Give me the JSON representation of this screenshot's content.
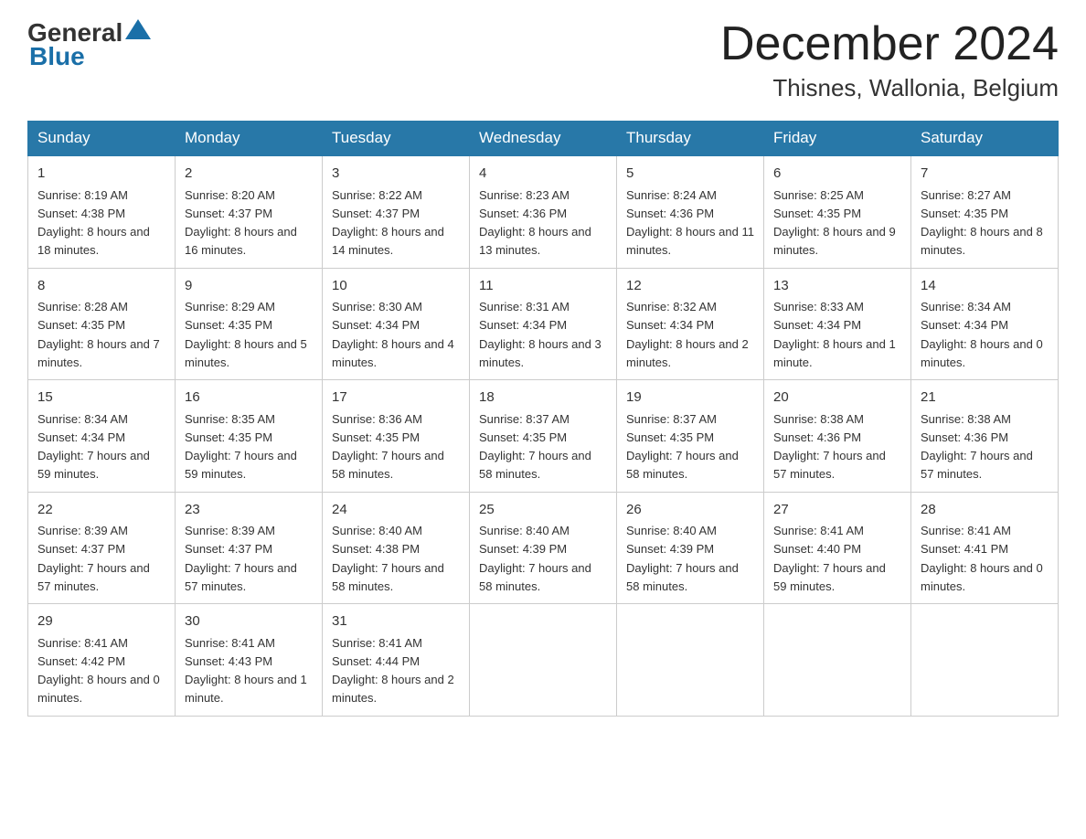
{
  "header": {
    "logo_general": "General",
    "logo_blue": "Blue",
    "month_year": "December 2024",
    "location": "Thisnes, Wallonia, Belgium"
  },
  "days_of_week": [
    "Sunday",
    "Monday",
    "Tuesday",
    "Wednesday",
    "Thursday",
    "Friday",
    "Saturday"
  ],
  "weeks": [
    [
      {
        "day": "1",
        "sunrise": "8:19 AM",
        "sunset": "4:38 PM",
        "daylight": "8 hours and 18 minutes."
      },
      {
        "day": "2",
        "sunrise": "8:20 AM",
        "sunset": "4:37 PM",
        "daylight": "8 hours and 16 minutes."
      },
      {
        "day": "3",
        "sunrise": "8:22 AM",
        "sunset": "4:37 PM",
        "daylight": "8 hours and 14 minutes."
      },
      {
        "day": "4",
        "sunrise": "8:23 AM",
        "sunset": "4:36 PM",
        "daylight": "8 hours and 13 minutes."
      },
      {
        "day": "5",
        "sunrise": "8:24 AM",
        "sunset": "4:36 PM",
        "daylight": "8 hours and 11 minutes."
      },
      {
        "day": "6",
        "sunrise": "8:25 AM",
        "sunset": "4:35 PM",
        "daylight": "8 hours and 9 minutes."
      },
      {
        "day": "7",
        "sunrise": "8:27 AM",
        "sunset": "4:35 PM",
        "daylight": "8 hours and 8 minutes."
      }
    ],
    [
      {
        "day": "8",
        "sunrise": "8:28 AM",
        "sunset": "4:35 PM",
        "daylight": "8 hours and 7 minutes."
      },
      {
        "day": "9",
        "sunrise": "8:29 AM",
        "sunset": "4:35 PM",
        "daylight": "8 hours and 5 minutes."
      },
      {
        "day": "10",
        "sunrise": "8:30 AM",
        "sunset": "4:34 PM",
        "daylight": "8 hours and 4 minutes."
      },
      {
        "day": "11",
        "sunrise": "8:31 AM",
        "sunset": "4:34 PM",
        "daylight": "8 hours and 3 minutes."
      },
      {
        "day": "12",
        "sunrise": "8:32 AM",
        "sunset": "4:34 PM",
        "daylight": "8 hours and 2 minutes."
      },
      {
        "day": "13",
        "sunrise": "8:33 AM",
        "sunset": "4:34 PM",
        "daylight": "8 hours and 1 minute."
      },
      {
        "day": "14",
        "sunrise": "8:34 AM",
        "sunset": "4:34 PM",
        "daylight": "8 hours and 0 minutes."
      }
    ],
    [
      {
        "day": "15",
        "sunrise": "8:34 AM",
        "sunset": "4:34 PM",
        "daylight": "7 hours and 59 minutes."
      },
      {
        "day": "16",
        "sunrise": "8:35 AM",
        "sunset": "4:35 PM",
        "daylight": "7 hours and 59 minutes."
      },
      {
        "day": "17",
        "sunrise": "8:36 AM",
        "sunset": "4:35 PM",
        "daylight": "7 hours and 58 minutes."
      },
      {
        "day": "18",
        "sunrise": "8:37 AM",
        "sunset": "4:35 PM",
        "daylight": "7 hours and 58 minutes."
      },
      {
        "day": "19",
        "sunrise": "8:37 AM",
        "sunset": "4:35 PM",
        "daylight": "7 hours and 58 minutes."
      },
      {
        "day": "20",
        "sunrise": "8:38 AM",
        "sunset": "4:36 PM",
        "daylight": "7 hours and 57 minutes."
      },
      {
        "day": "21",
        "sunrise": "8:38 AM",
        "sunset": "4:36 PM",
        "daylight": "7 hours and 57 minutes."
      }
    ],
    [
      {
        "day": "22",
        "sunrise": "8:39 AM",
        "sunset": "4:37 PM",
        "daylight": "7 hours and 57 minutes."
      },
      {
        "day": "23",
        "sunrise": "8:39 AM",
        "sunset": "4:37 PM",
        "daylight": "7 hours and 57 minutes."
      },
      {
        "day": "24",
        "sunrise": "8:40 AM",
        "sunset": "4:38 PM",
        "daylight": "7 hours and 58 minutes."
      },
      {
        "day": "25",
        "sunrise": "8:40 AM",
        "sunset": "4:39 PM",
        "daylight": "7 hours and 58 minutes."
      },
      {
        "day": "26",
        "sunrise": "8:40 AM",
        "sunset": "4:39 PM",
        "daylight": "7 hours and 58 minutes."
      },
      {
        "day": "27",
        "sunrise": "8:41 AM",
        "sunset": "4:40 PM",
        "daylight": "7 hours and 59 minutes."
      },
      {
        "day": "28",
        "sunrise": "8:41 AM",
        "sunset": "4:41 PM",
        "daylight": "8 hours and 0 minutes."
      }
    ],
    [
      {
        "day": "29",
        "sunrise": "8:41 AM",
        "sunset": "4:42 PM",
        "daylight": "8 hours and 0 minutes."
      },
      {
        "day": "30",
        "sunrise": "8:41 AM",
        "sunset": "4:43 PM",
        "daylight": "8 hours and 1 minute."
      },
      {
        "day": "31",
        "sunrise": "8:41 AM",
        "sunset": "4:44 PM",
        "daylight": "8 hours and 2 minutes."
      },
      null,
      null,
      null,
      null
    ]
  ],
  "labels": {
    "sunrise": "Sunrise:",
    "sunset": "Sunset:",
    "daylight": "Daylight:"
  }
}
